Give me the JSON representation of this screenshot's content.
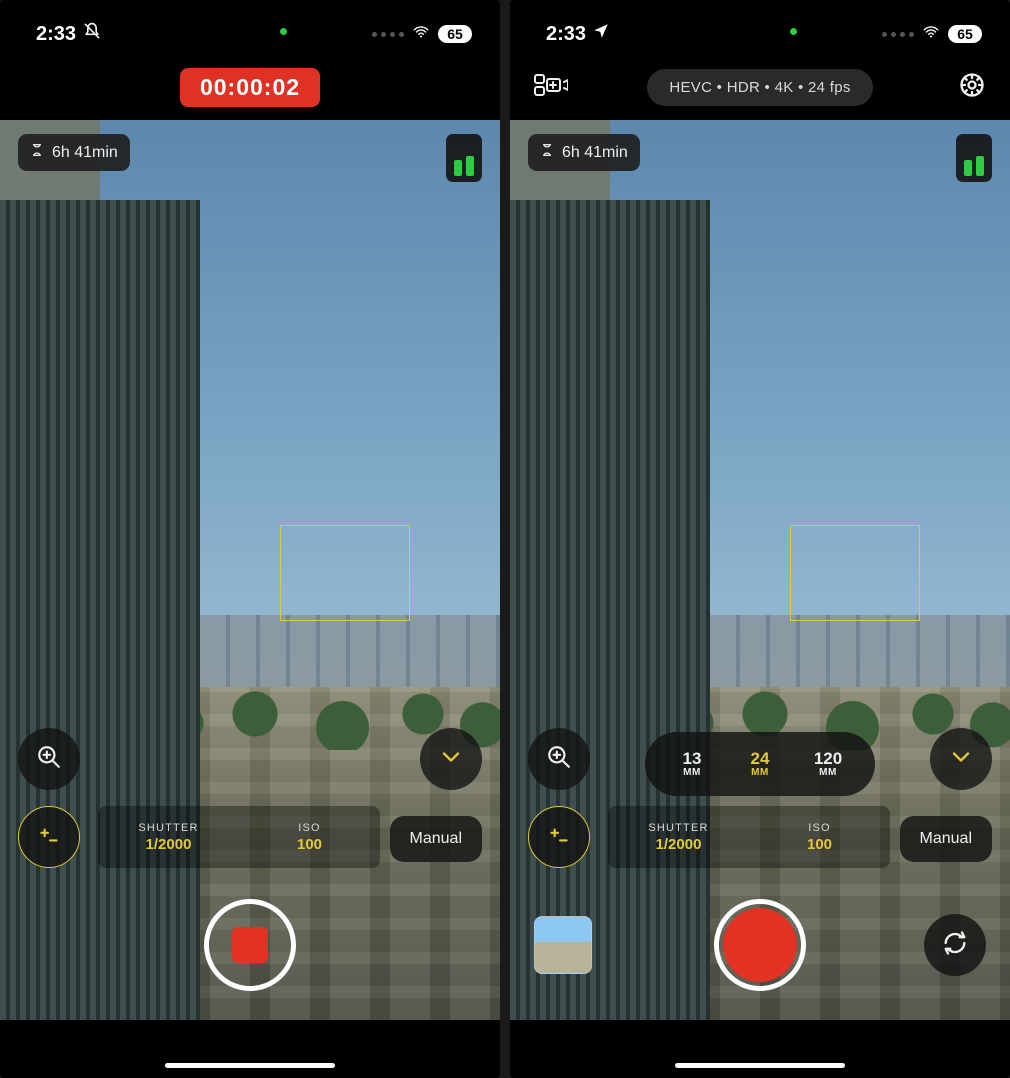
{
  "left": {
    "status": {
      "time": "2:33",
      "battery": "65"
    },
    "toolbar": {
      "timer": "00:00:02"
    },
    "overlay": {
      "remaining": "6h 41min"
    },
    "params": {
      "shutter": {
        "label": "SHUTTER",
        "value": "1/2000"
      },
      "iso": {
        "label": "ISO",
        "value": "100"
      }
    },
    "manual_label": "Manual"
  },
  "right": {
    "status": {
      "time": "2:33",
      "battery": "65"
    },
    "toolbar": {
      "format": "HEVC  •  HDR  •  4K  •  24 fps"
    },
    "overlay": {
      "remaining": "6h 41min"
    },
    "lenses": [
      {
        "value": "13",
        "unit": "MM"
      },
      {
        "value": "24",
        "unit": "MM"
      },
      {
        "value": "120",
        "unit": "MM"
      }
    ],
    "lens_active_index": 1,
    "params": {
      "shutter": {
        "label": "SHUTTER",
        "value": "1/2000"
      },
      "iso": {
        "label": "ISO",
        "value": "100"
      }
    },
    "manual_label": "Manual"
  }
}
